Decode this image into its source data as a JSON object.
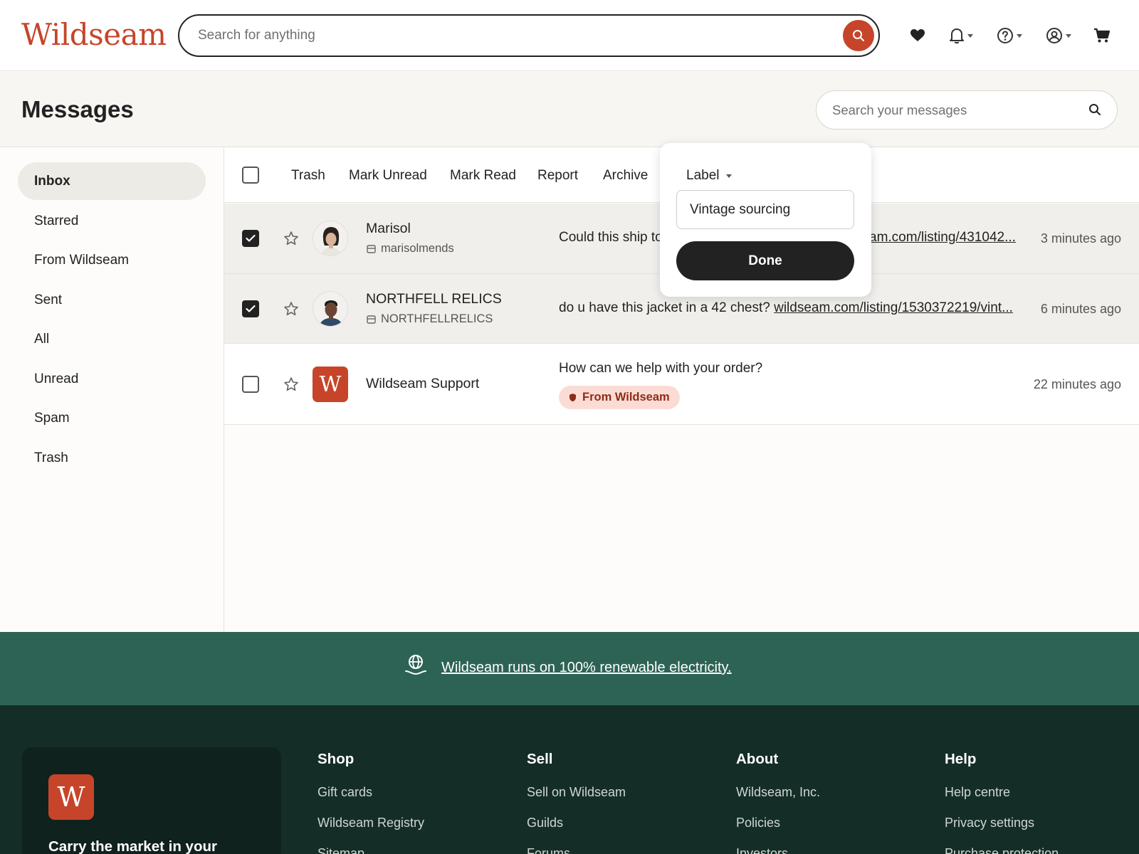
{
  "header": {
    "logo": "Wildseam",
    "search_placeholder": "Search for anything"
  },
  "page": {
    "title": "Messages",
    "search_placeholder": "Search your messages"
  },
  "sidebar": {
    "items": [
      {
        "label": "Inbox",
        "active": true
      },
      {
        "label": "Starred"
      },
      {
        "label": "From Wildseam"
      },
      {
        "label": "Sent"
      },
      {
        "label": "All"
      },
      {
        "label": "Unread"
      },
      {
        "label": "Spam"
      },
      {
        "label": "Trash"
      }
    ]
  },
  "toolbar": {
    "trash": "Trash",
    "mark_unread": "Mark Unread",
    "mark_read": "Mark Read",
    "report": "Report",
    "archive": "Archive"
  },
  "label_popover": {
    "label": "Label",
    "input_value": "Vintage sourcing",
    "done": "Done"
  },
  "messages": [
    {
      "sender": "Marisol",
      "handle": "marisolmends",
      "snippet_text": "Could this ship to",
      "snippet_link": "am.com/listing/431042...",
      "time": "3 minutes ago",
      "selected": true
    },
    {
      "sender": "NORTHFELL RELICS",
      "handle": "NORTHFELLRELICS",
      "snippet_text": "do u have this jacket in a 42 chest?",
      "snippet_link": "wildseam.com/listing/1530372219/vint...",
      "time": "6 minutes ago",
      "selected": true
    },
    {
      "sender": "Wildseam Support",
      "snippet_text": "How can we help with your order?",
      "badge": "From Wildseam",
      "time": "22 minutes ago",
      "selected": false
    }
  ],
  "banner": {
    "text": "Wildseam runs on 100% renewable electricity."
  },
  "footer": {
    "app_card_text": "Carry the market in your",
    "app_logo_letter": "W",
    "columns": [
      {
        "heading": "Shop",
        "links": [
          "Gift cards",
          "Wildseam Registry",
          "Sitemap"
        ]
      },
      {
        "heading": "Sell",
        "links": [
          "Sell on Wildseam",
          "Guilds",
          "Forums"
        ]
      },
      {
        "heading": "About",
        "links": [
          "Wildseam, Inc.",
          "Policies",
          "Investors"
        ]
      },
      {
        "heading": "Help",
        "links": [
          "Help centre",
          "Privacy settings",
          "Purchase protection"
        ]
      }
    ]
  },
  "support_logo_letter": "W",
  "colors": {
    "brand": "#c6452a",
    "banner_green": "#2d6354",
    "footer_dark": "#142d27",
    "badge_bg": "#fbdcd4"
  }
}
